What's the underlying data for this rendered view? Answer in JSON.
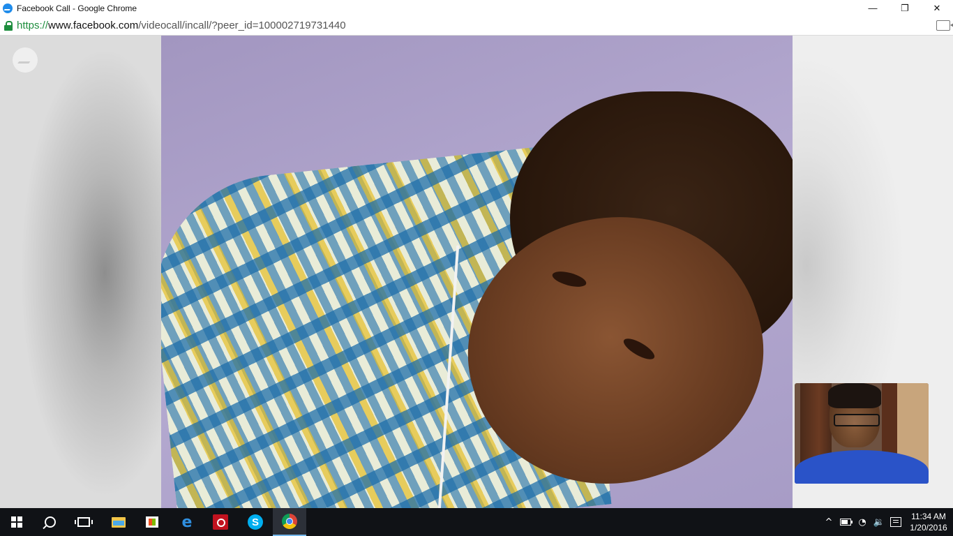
{
  "window": {
    "title": "Facebook Call - Google Chrome",
    "app_icon": "messenger-icon",
    "controls": {
      "minimize": "—",
      "restore": "❐",
      "close": "✕"
    }
  },
  "address_bar": {
    "scheme": "https://",
    "host": "www.facebook.com",
    "path": "/videocall/incall/?peer_id=100002719731440",
    "secure_icon": "lock-icon",
    "right_icon": "camera-icon"
  },
  "call": {
    "brand_icon": "messenger-logo-icon",
    "remote_video": "remote participant video feed",
    "self_view": "local camera preview"
  },
  "taskbar": {
    "start_icon": "windows-start-icon",
    "items": [
      {
        "name": "search",
        "icon": "search-icon"
      },
      {
        "name": "task-view",
        "icon": "task-view-icon"
      },
      {
        "name": "file-explorer",
        "icon": "folder-icon"
      },
      {
        "name": "store",
        "icon": "store-icon"
      },
      {
        "name": "edge",
        "icon": "edge-icon",
        "glyph": "e"
      },
      {
        "name": "red-app",
        "icon": "app-icon"
      },
      {
        "name": "skype",
        "icon": "skype-icon",
        "glyph": "S"
      },
      {
        "name": "chrome",
        "icon": "chrome-icon",
        "active": true
      }
    ],
    "tray": {
      "chevron": "^",
      "time": "11:34 AM",
      "date": "1/20/2016"
    }
  },
  "colors": {
    "taskbar_bg": "#101216",
    "secure_green": "#1e8e3e",
    "active_accent": "#76b9ed"
  }
}
